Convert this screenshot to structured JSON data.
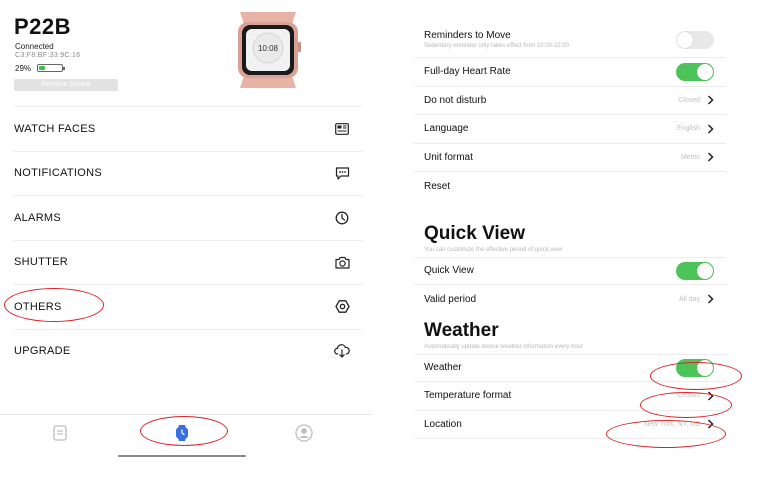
{
  "device": {
    "name": "P22B",
    "status": "Connected",
    "mac": "C3:F8:BF:33:9C:16",
    "battery": "29%",
    "battery_level": 0.29,
    "remove_label": "Remove Device",
    "watch_time": "10:08"
  },
  "menu": {
    "items": [
      {
        "label": "WATCH FACES",
        "icon": "watch-face-icon"
      },
      {
        "label": "NOTIFICATIONS",
        "icon": "message-icon"
      },
      {
        "label": "ALARMS",
        "icon": "clock-icon"
      },
      {
        "label": "SHUTTER",
        "icon": "camera-icon"
      },
      {
        "label": "OTHERS",
        "icon": "gear-icon"
      },
      {
        "label": "UPGRADE",
        "icon": "cloud-download-icon"
      }
    ]
  },
  "tabbar": {
    "tabs": [
      {
        "icon": "list-icon"
      },
      {
        "icon": "watch-icon",
        "active": true
      },
      {
        "icon": "profile-icon"
      }
    ]
  },
  "settings": {
    "reminders": {
      "title": "Reminders to Move",
      "sub": "Sedentary reminder only takes effect from 10:00-22:00",
      "on": false
    },
    "heart_rate": {
      "title": "Full-day Heart Rate",
      "on": true
    },
    "dnd": {
      "title": "Do not disturb",
      "value": "Closed"
    },
    "language": {
      "title": "Language",
      "value": "English"
    },
    "unit": {
      "title": "Unit format",
      "value": "Metric"
    },
    "reset": {
      "title": "Reset"
    }
  },
  "quick_view": {
    "title": "Quick View",
    "sub": "You can customize the effective period of quick view",
    "toggle": {
      "title": "Quick View",
      "on": true
    },
    "period": {
      "title": "Valid period",
      "value": "All day"
    }
  },
  "weather": {
    "title": "Weather",
    "sub": "Automatically update device weather information every hour",
    "toggle": {
      "title": "Weather",
      "on": true
    },
    "temp": {
      "title": "Temperature format",
      "value": "Celsius"
    },
    "location": {
      "title": "Location",
      "value": "New York, NY, US"
    }
  },
  "colors": {
    "toggle_on": "#4cc45a",
    "toggle_off": "#e8e8e8",
    "battery": "#3cc24a",
    "annotation": "#d9222a",
    "active_tab": "#3a6fe0"
  }
}
